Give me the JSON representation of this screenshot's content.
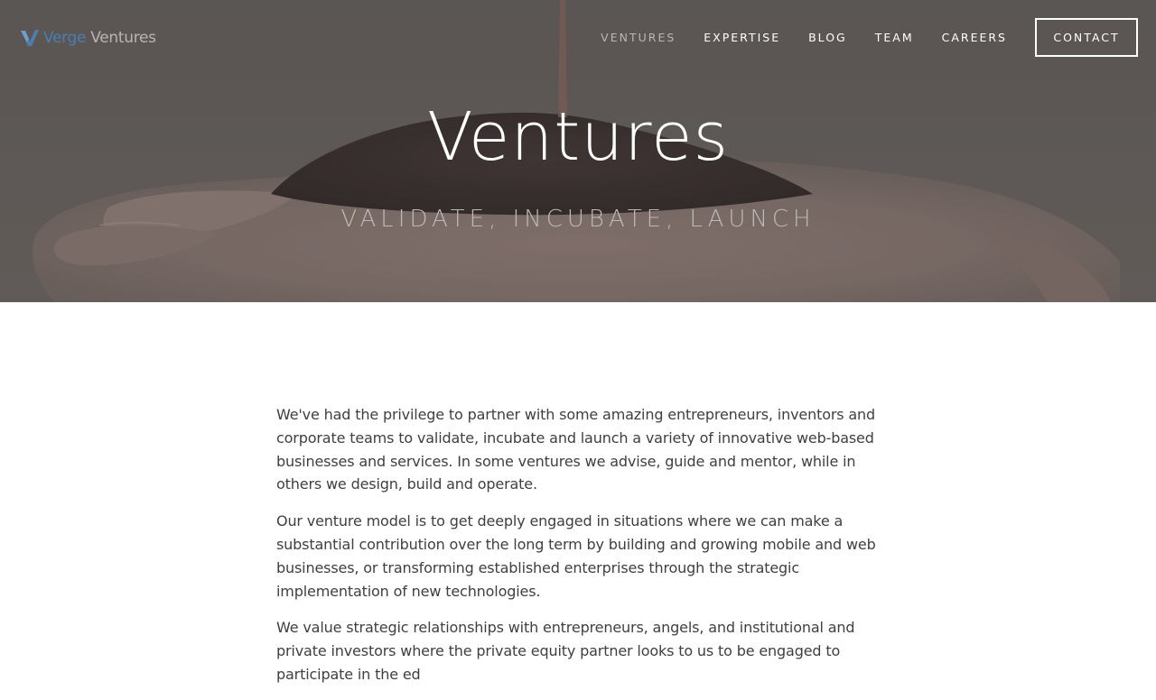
{
  "logo": {
    "name_part1": "Verge",
    "name_part2": "Ventures",
    "icon": "v-logo-icon",
    "brand_color": "#4a7fb0"
  },
  "nav": {
    "items": [
      {
        "label": "VENTURES",
        "active": true
      },
      {
        "label": "EXPERTISE",
        "active": false
      },
      {
        "label": "BLOG",
        "active": false
      },
      {
        "label": "TEAM",
        "active": false
      },
      {
        "label": "CAREERS",
        "active": false
      }
    ],
    "contact_label": "CONTACT"
  },
  "hero": {
    "title": "Ventures",
    "subtitle": "VALIDATE, INCUBATE, LAUNCH"
  },
  "content": {
    "paragraphs": [
      "We've had the privilege to partner with some amazing entrepreneurs, inventors and corporate teams to validate, incubate and launch a variety of innovative web-based businesses and services. In some ventures we advise, guide and mentor, while in others we design, build and operate.",
      "Our venture model is to get deeply engaged in situations where we can make a substantial contribution over the long term by building and growing mobile and web businesses, or transforming established enterprises through the strategic implementation of new technologies.",
      "We value strategic relationships with entrepreneurs, angels, and institutional and private investors where the private equity partner looks to us to be engaged to participate in the ed"
    ]
  },
  "colors": {
    "nav_text": "#ffffff",
    "nav_active": "#b9b6b3",
    "body_text": "#3f3f3f"
  }
}
